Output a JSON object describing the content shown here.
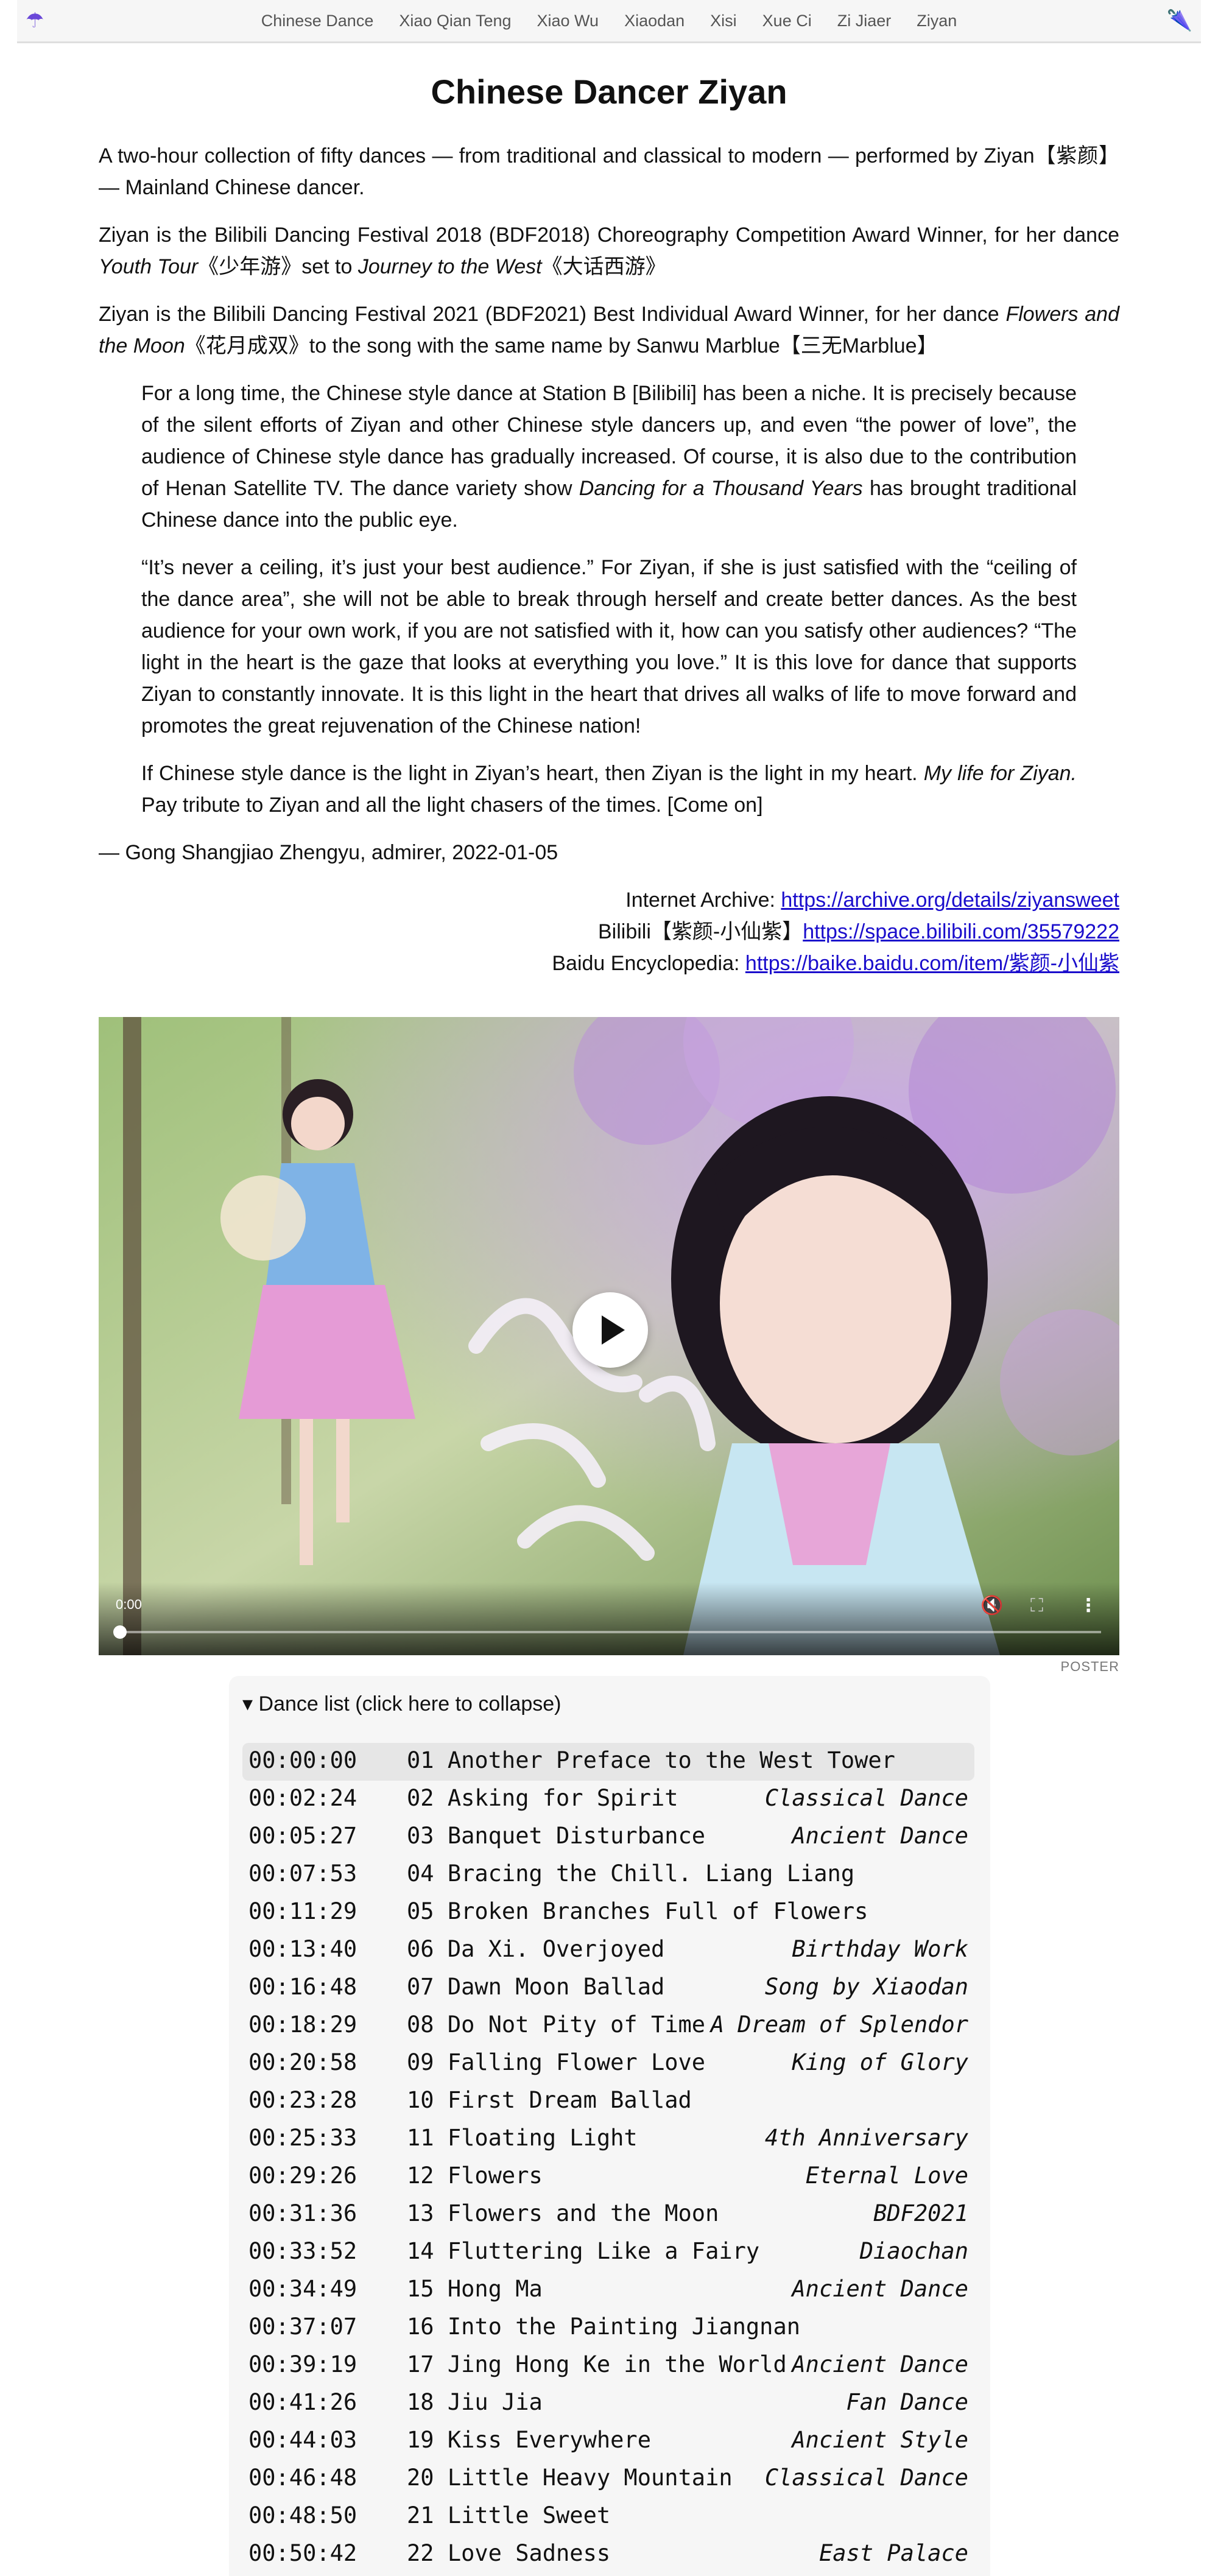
{
  "nav": {
    "items": [
      "Chinese Dance",
      "Xiao Qian Teng",
      "Xiao Wu",
      "Xiaodan",
      "Xisi",
      "Xue Ci",
      "Zi Jiaer",
      "Ziyan"
    ]
  },
  "page": {
    "title": "Chinese Dancer Ziyan",
    "intro": "A two-hour collection of fifty dances — from traditional and classical to modern — performed by Ziyan【紫颜】— Mainland Chinese dancer.",
    "award1_prefix": "Ziyan is the Bilibili Dancing Festival 2018 (BDF2018) Choreography Competition Award Winner, for her dance ",
    "award1_title": "Youth Tour",
    "award1_mid": "《少年游》set to ",
    "award1_song": "Journey to the West",
    "award1_suffix": "《大话西游》",
    "award2_prefix": "Ziyan is the Bilibili Dancing Festival 2021 (BDF2021) Best Individual Award Winner, for her dance ",
    "award2_title": "Flowers and the Moon",
    "award2_suffix": "《花月成双》to the song with the same name by Sanwu Marblue【三无Marblue】",
    "quote1_a": "For a long time, the Chinese style dance at Station B [Bilibili] has been a niche. It is precisely because of the silent efforts of Ziyan and other Chinese style dancers up, and even “the power of love”, the audience of Chinese style dance has gradually increased. Of course, it is also due to the contribution of Henan Satellite TV. The dance variety show ",
    "quote1_show": "Dancing for a Thousand Years",
    "quote1_b": " has brought traditional Chinese dance into the public eye.",
    "quote2": "“It’s never a ceiling, it’s just your best audience.” For Ziyan, if she is just satisfied with the “ceiling of the dance area”, she will not be able to break through herself and create better dances. As the best audience for your own work, if you are not satisfied with it, how can you satisfy other audiences? “The light in the heart is the gaze that looks at everything you love.” It is this love for dance that supports Ziyan to constantly innovate. It is this light in the heart that drives all walks of life to move forward and promotes the great rejuvenation of the Chinese nation!",
    "quote3_a": "If Chinese style dance is the light in Ziyan’s heart, then Ziyan is the light in my heart. ",
    "quote3_em": "My life for Ziyan.",
    "quote3_b": " Pay tribute to Ziyan and all the light chasers of the times. [Come on]",
    "attribution": "— Gong Shangjiao Zhengyu, admirer, 2022-01-05",
    "links": [
      {
        "label": "Internet Archive: ",
        "url": "https://archive.org/details/ziyansweet"
      },
      {
        "label": "Bilibili【紫颜-小仙紫】",
        "url": "https://space.bilibili.com/35579222"
      },
      {
        "label": "Baidu Encyclopedia: ",
        "url": "https://baike.baidu.com/item/紫颜-小仙紫"
      }
    ]
  },
  "video": {
    "time": "0:00",
    "poster_label": "POSTER",
    "progress": 0
  },
  "dance_list": {
    "summary": "▾ Dance list (click here to collapse)",
    "rows": [
      {
        "time": "00:00:00",
        "title": "01 Another Preface to the West Tower",
        "tag": ""
      },
      {
        "time": "00:02:24",
        "title": "02 Asking for Spirit",
        "tag": "Classical Dance"
      },
      {
        "time": "00:05:27",
        "title": "03 Banquet Disturbance",
        "tag": "Ancient Dance"
      },
      {
        "time": "00:07:53",
        "title": "04 Bracing the Chill. Liang Liang",
        "tag": ""
      },
      {
        "time": "00:11:29",
        "title": "05 Broken Branches Full of Flowers",
        "tag": ""
      },
      {
        "time": "00:13:40",
        "title": "06 Da Xi. Overjoyed",
        "tag": "Birthday Work"
      },
      {
        "time": "00:16:48",
        "title": "07 Dawn Moon Ballad",
        "tag": "Song by Xiaodan"
      },
      {
        "time": "00:18:29",
        "title": "08 Do Not Pity of Time",
        "tag": "A Dream of Splendor"
      },
      {
        "time": "00:20:58",
        "title": "09 Falling Flower Love",
        "tag": "King of Glory"
      },
      {
        "time": "00:23:28",
        "title": "10 First Dream Ballad",
        "tag": ""
      },
      {
        "time": "00:25:33",
        "title": "11 Floating Light",
        "tag": "4th Anniversary"
      },
      {
        "time": "00:29:26",
        "title": "12 Flowers",
        "tag": "Eternal Love"
      },
      {
        "time": "00:31:36",
        "title": "13 Flowers and the Moon",
        "tag": "BDF2021"
      },
      {
        "time": "00:33:52",
        "title": "14 Fluttering Like a Fairy",
        "tag": "Diaochan"
      },
      {
        "time": "00:34:49",
        "title": "15 Hong Ma",
        "tag": "Ancient Dance"
      },
      {
        "time": "00:37:07",
        "title": "16 Into the Painting Jiangnan",
        "tag": ""
      },
      {
        "time": "00:39:19",
        "title": "17 Jing Hong Ke in the World",
        "tag": "Ancient Dance"
      },
      {
        "time": "00:41:26",
        "title": "18 Jiu Jia",
        "tag": "Fan Dance"
      },
      {
        "time": "00:44:03",
        "title": "19 Kiss Everywhere",
        "tag": "Ancient Style"
      },
      {
        "time": "00:46:48",
        "title": "20 Little Heavy Mountain",
        "tag": "Classical Dance"
      },
      {
        "time": "00:48:50",
        "title": "21 Little Sweet",
        "tag": ""
      },
      {
        "time": "00:50:42",
        "title": "22 Love Sadness",
        "tag": "East Palace"
      }
    ]
  }
}
